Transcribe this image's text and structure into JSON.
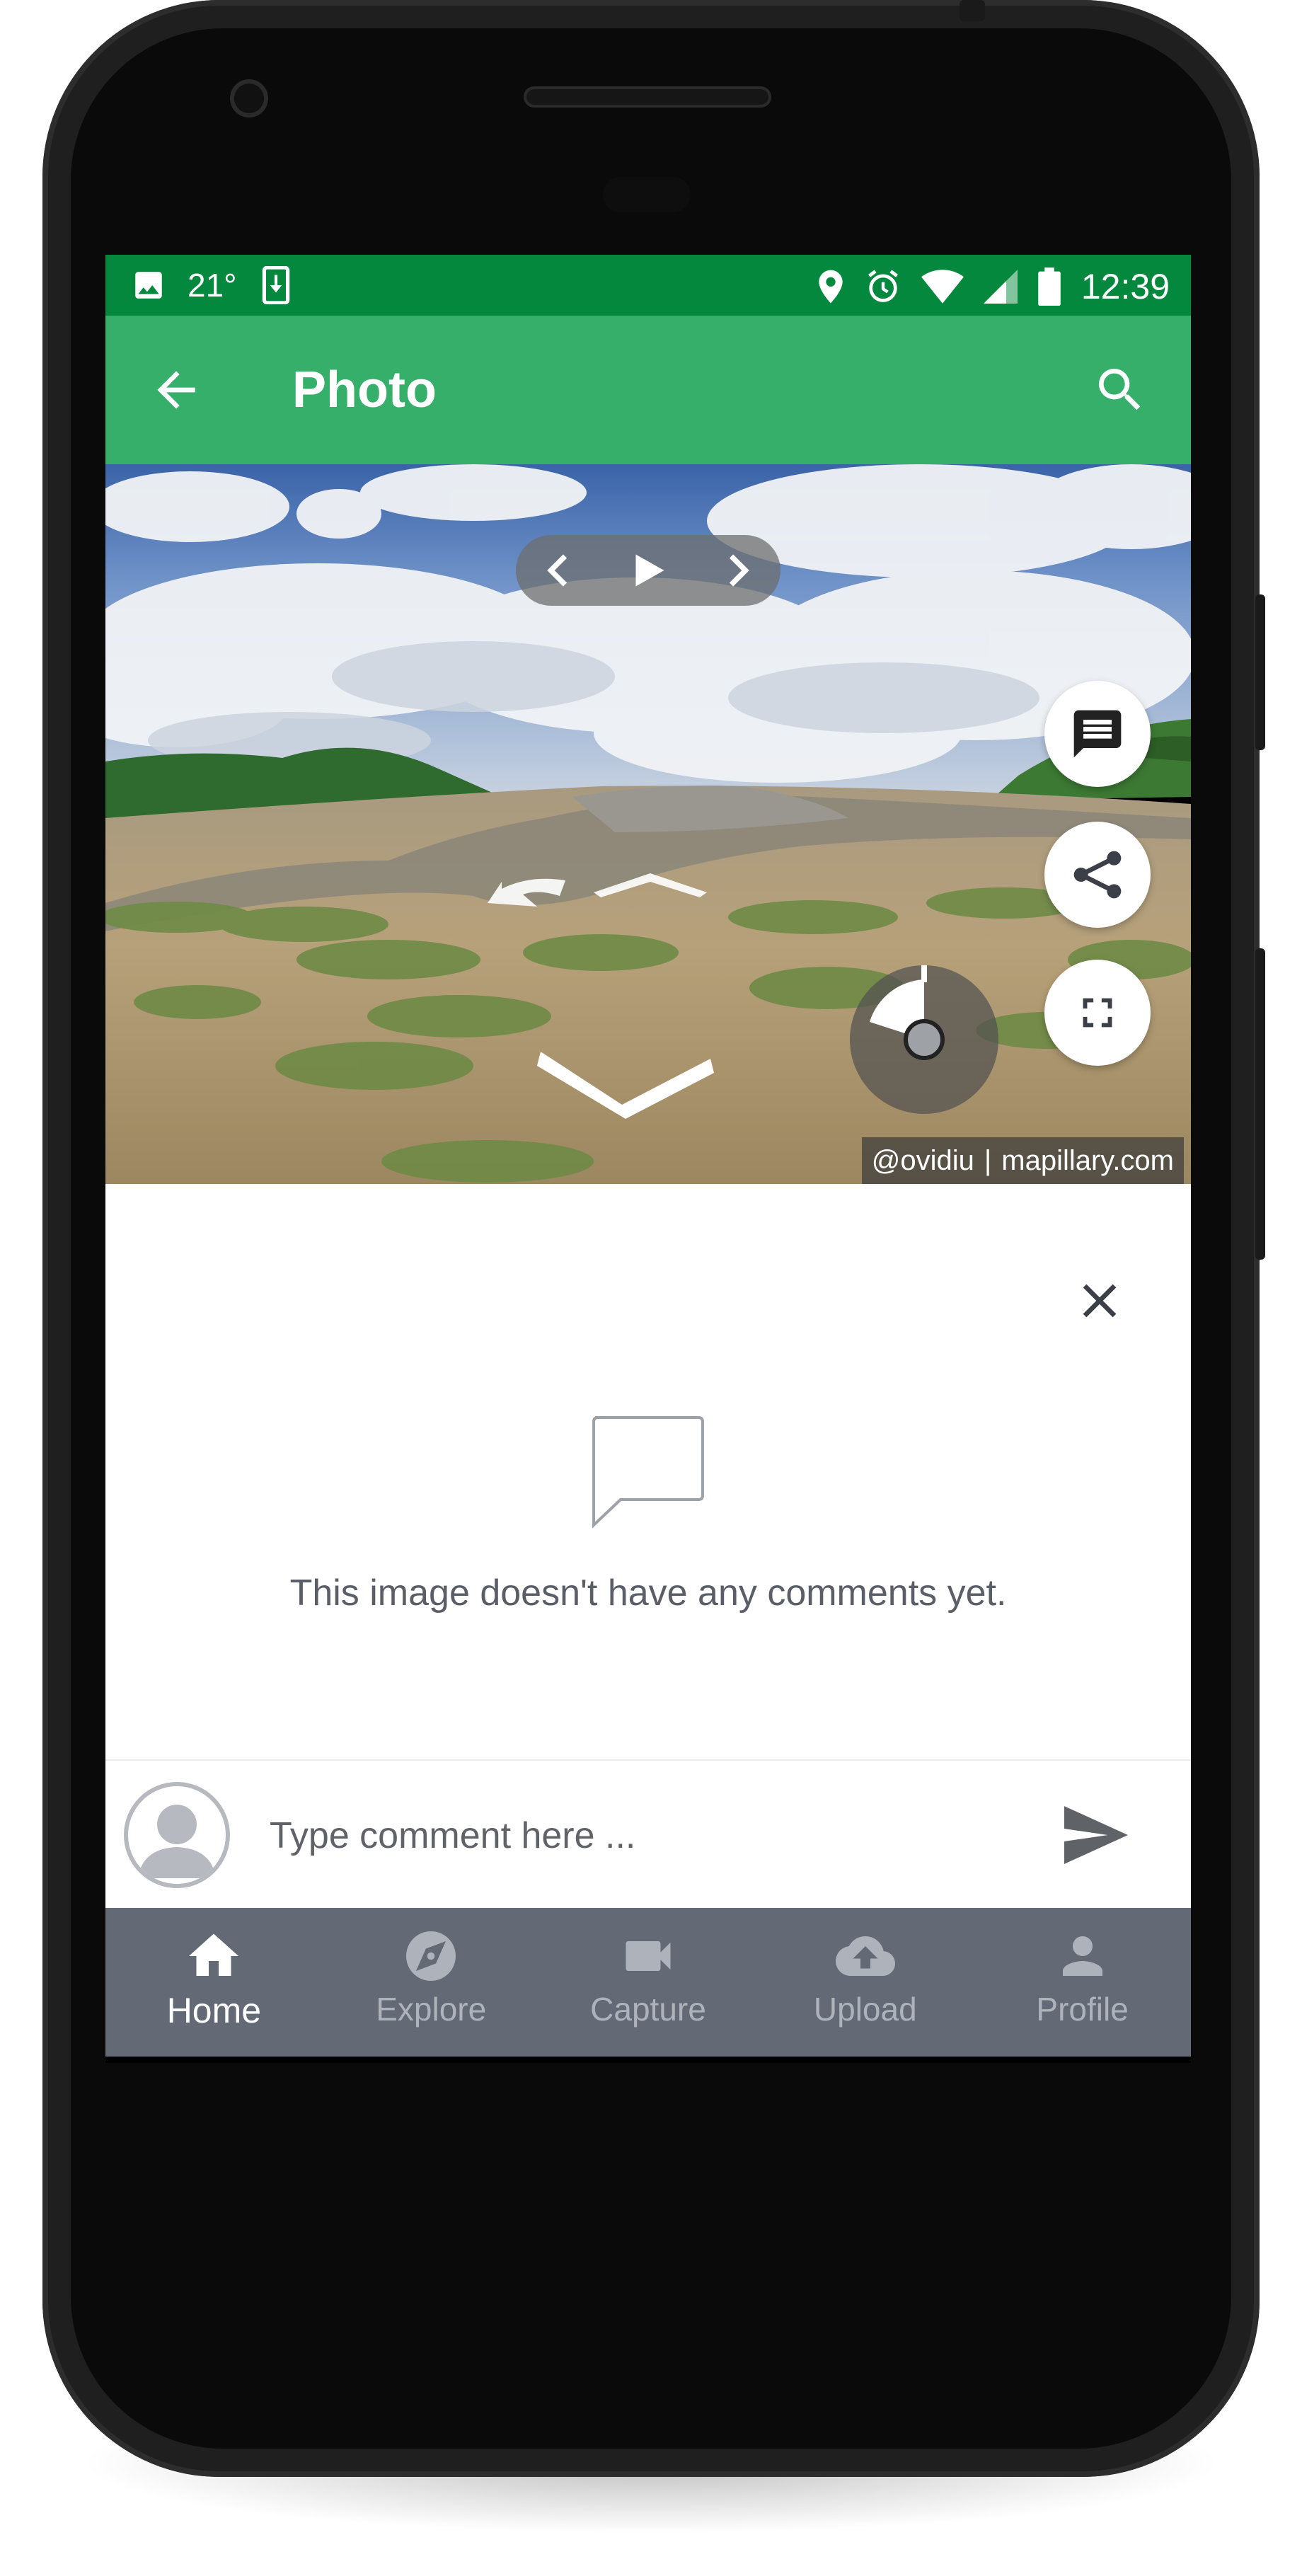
{
  "status_bar": {
    "temperature": "21°",
    "time": "12:39",
    "icons": [
      "image-icon",
      "download-icon",
      "location-icon",
      "alarm-icon",
      "wifi-icon",
      "signal-icon",
      "battery-icon"
    ]
  },
  "app_bar": {
    "title": "Photo",
    "back_icon": "arrow-back-icon",
    "search_icon": "search-icon",
    "color": "#36af6a"
  },
  "viewer": {
    "attribution_user": "@ovidiu",
    "attribution_separator": "|",
    "attribution_site": "mapillary.com",
    "controls": [
      "prev-icon",
      "play-icon",
      "next-icon"
    ],
    "fabs": [
      "comment-icon",
      "share-icon",
      "fullscreen-icon"
    ]
  },
  "comments": {
    "empty_message": "This image doesn't have any comments yet.",
    "input_placeholder": "Type comment here ..."
  },
  "bottom_nav": {
    "items": [
      {
        "label": "Home",
        "icon": "home-icon",
        "active": true
      },
      {
        "label": "Explore",
        "icon": "explore-icon",
        "active": false
      },
      {
        "label": "Capture",
        "icon": "video-camera-icon",
        "active": false
      },
      {
        "label": "Upload",
        "icon": "cloud-upload-icon",
        "active": false
      },
      {
        "label": "Profile",
        "icon": "person-icon",
        "active": false
      }
    ]
  },
  "colors": {
    "status_bar": "#04883d",
    "accent": "#36af6a",
    "bottom_nav": "#636a75"
  }
}
